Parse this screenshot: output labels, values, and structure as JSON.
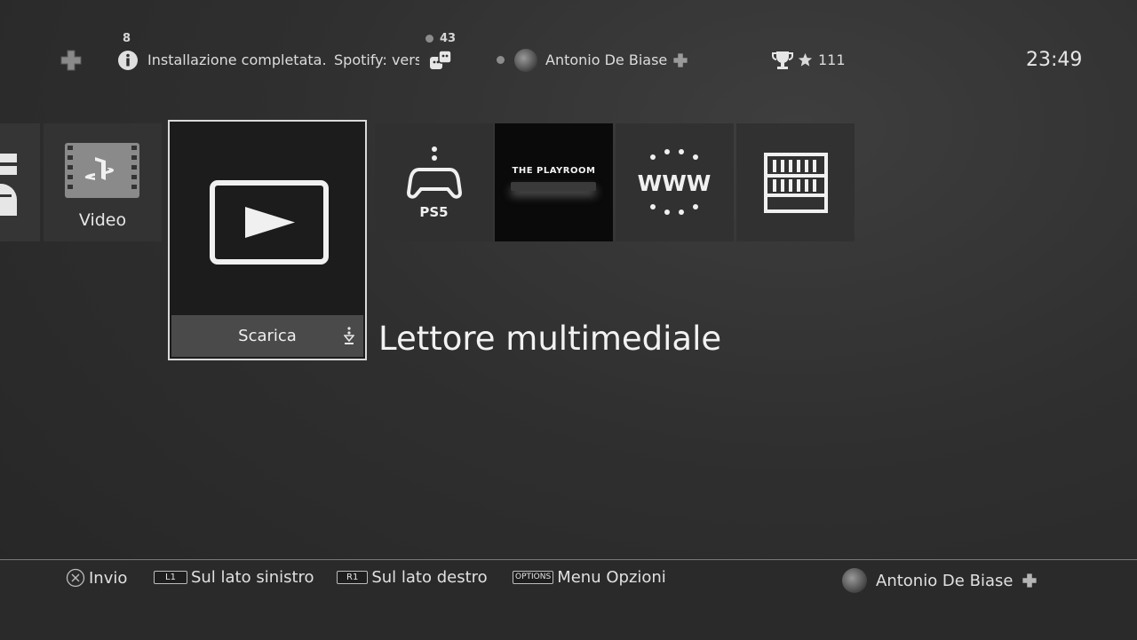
{
  "topbar": {
    "notifications_count": "8",
    "notification_text": "Installazione completata.",
    "notification_text2": "Spotify: vers",
    "friends_count": "43",
    "username": "Antonio De Biase",
    "trophy_count": "111",
    "clock": "23:49"
  },
  "tiles": {
    "video_label": "Video",
    "focused_action": "Scarica",
    "ps5_label": "PS5",
    "playroom_label": "THE PLAYROOM",
    "www_label": "WWW"
  },
  "selected_title": "Lettore multimediale",
  "bottombar": {
    "cross_label": "Invio",
    "l1_key": "L1",
    "l1_label": "Sul lato sinistro",
    "r1_key": "R1",
    "r1_label": "Sul lato destro",
    "options_key": "OPTIONS",
    "options_label": "Menu Opzioni",
    "username": "Antonio De Biase"
  },
  "icons": [
    "plus-icon",
    "info-icon",
    "friends-icon",
    "trophy-icon",
    "star-icon",
    "cross-button-icon",
    "play-icon",
    "controller-icon",
    "library-icon"
  ]
}
